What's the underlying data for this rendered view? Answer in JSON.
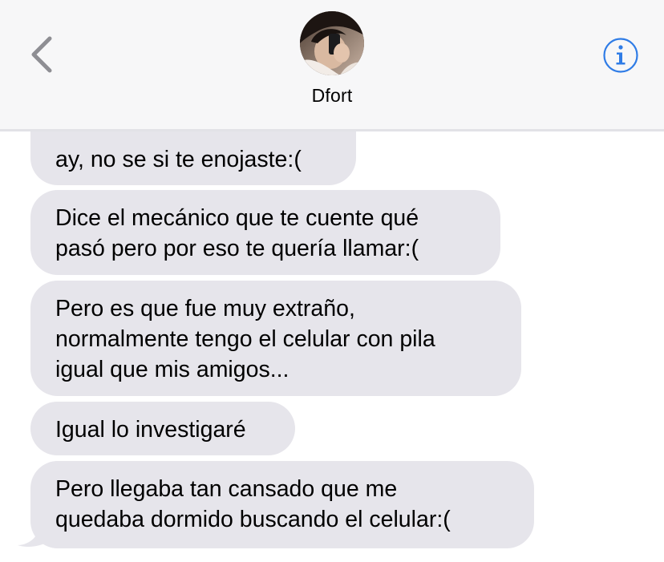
{
  "header": {
    "contact_name": "Dfort",
    "back_icon": "chevron-left-icon",
    "info_icon": "info-icon",
    "accent_color": "#2f7ce6"
  },
  "messages": [
    {
      "lines": [
        "ay, no se si te enojaste:("
      ]
    },
    {
      "lines": [
        "Dice el mecánico que te cuente qué",
        "pasó pero por eso te quería llamar:("
      ]
    },
    {
      "lines": [
        "Pero es que fue muy extraño,",
        "normalmente tengo el celular con pila",
        "igual que mis amigos..."
      ]
    },
    {
      "lines": [
        "Igual lo investigaré"
      ]
    },
    {
      "lines": [
        "Pero llegaba tan cansado que me",
        "quedaba dormido buscando el celular:("
      ]
    }
  ],
  "colors": {
    "incoming_bubble": "#e6e5eb",
    "header_background": "#f7f7f8"
  }
}
